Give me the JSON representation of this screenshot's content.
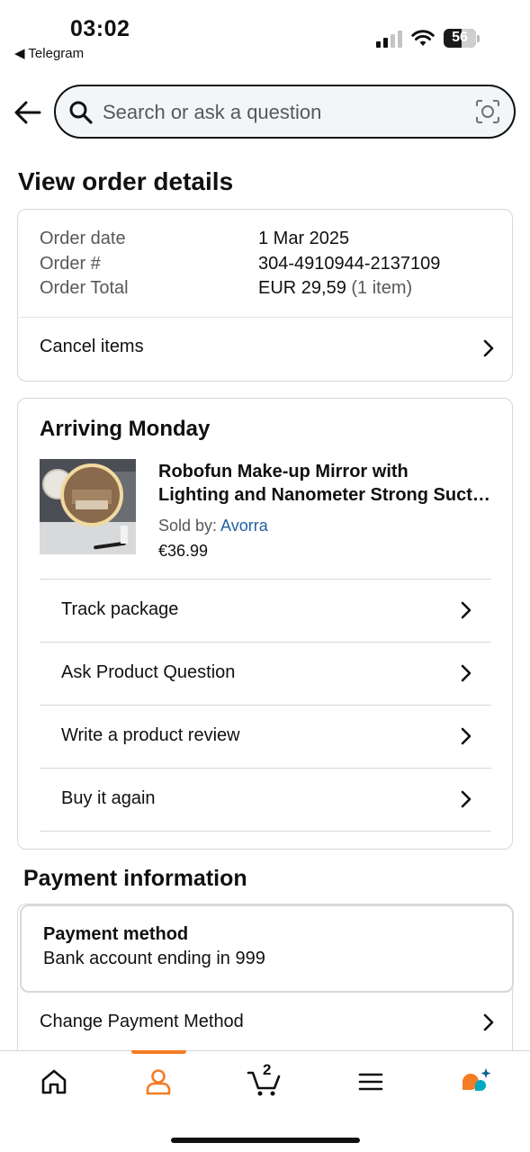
{
  "status_bar": {
    "time": "03:02",
    "back_app": "◀ Telegram",
    "battery": "56",
    "battery_level_percent": 56
  },
  "search": {
    "placeholder": "Search or ask a question"
  },
  "page_title": "View order details",
  "order_summary": {
    "rows": [
      {
        "label": "Order date",
        "value": "1 Mar 2025",
        "sub": ""
      },
      {
        "label": "Order #",
        "value": "304-4910944-2137109",
        "sub": ""
      },
      {
        "label": "Order Total",
        "value": "EUR 29,59",
        "sub": " (1 item)"
      }
    ],
    "cancel_label": "Cancel items"
  },
  "shipment": {
    "status": "Arriving Monday",
    "product": {
      "title_line1": "Robofun Make-up Mirror with",
      "title_line2": "Lighting and Nanometer Strong Suction",
      "sold_by_label": "Sold by: ",
      "seller": "Avorra",
      "price": "€36.99"
    },
    "actions": [
      {
        "label": "Track package"
      },
      {
        "label": "Ask Product Question"
      },
      {
        "label": "Write a product review"
      },
      {
        "label": "Buy it again"
      }
    ]
  },
  "payment": {
    "section_title": "Payment information",
    "method_heading": "Payment method",
    "method_value": "Bank account ending in 999",
    "change_label": "Change Payment Method"
  },
  "bottom_nav": {
    "items": [
      {
        "icon": "home-icon"
      },
      {
        "icon": "account-icon",
        "active": true
      },
      {
        "icon": "cart-icon",
        "count": "2"
      },
      {
        "icon": "menu-icon"
      },
      {
        "icon": "rufus-assistant-icon"
      }
    ]
  },
  "colors": {
    "accent": "#f47c24",
    "link": "#2162a1",
    "text": "#0f1111",
    "muted": "#565959",
    "border": "#d5d9d9"
  }
}
